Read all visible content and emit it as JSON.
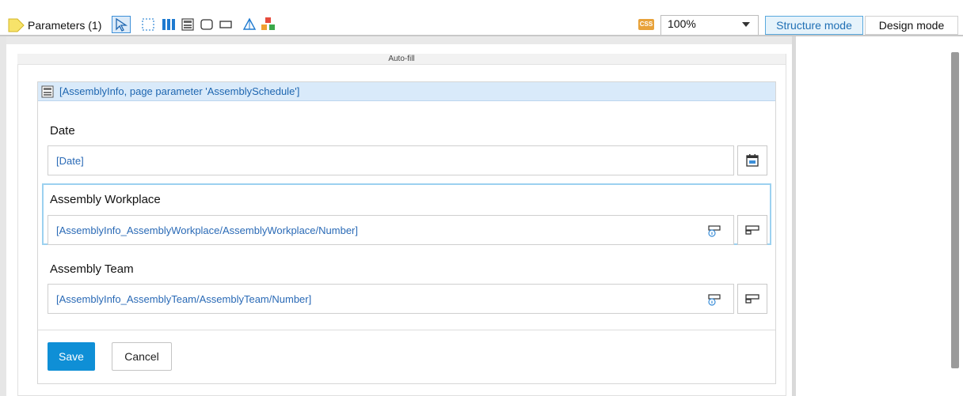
{
  "toolbar": {
    "parameters_label": "Parameters (1)",
    "tools": [
      "select-tool",
      "region-tool",
      "columns-tool",
      "form-tool",
      "box-tool",
      "rectangle-tool",
      "shape-tool",
      "component-tool"
    ],
    "css_badge": "CSS",
    "zoom": "100%",
    "structure_mode": "Structure mode",
    "design_mode": "Design mode"
  },
  "canvas": {
    "autofill_label": "Auto-fill"
  },
  "form": {
    "header": "[AssemblyInfo, page parameter 'AssemblySchedule']",
    "fields": [
      {
        "label": "Date",
        "value": "[Date]",
        "button_icon": "calendar-icon"
      },
      {
        "label": "Assembly Workplace",
        "value": "[AssemblyInfo_AssemblyWorkplace/AssemblyWorkplace/Number]",
        "button_icon": "lookup-icon"
      },
      {
        "label": "Assembly Team",
        "value": "[AssemblyInfo_AssemblyTeam/AssemblyTeam/Number]",
        "button_icon": "lookup-icon"
      }
    ],
    "save_label": "Save",
    "cancel_label": "Cancel"
  },
  "colors": {
    "accent": "#0f8fd6",
    "header_bg": "#d9eafa",
    "link_text": "#2a6ab6",
    "focus_border": "#9cd1f0"
  }
}
